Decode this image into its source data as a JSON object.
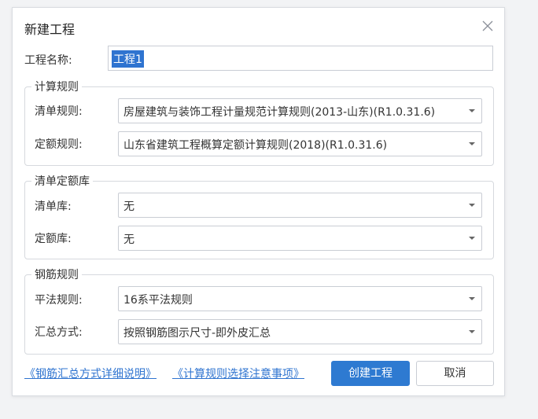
{
  "dialog": {
    "title": "新建工程",
    "close_icon": "close-icon"
  },
  "project_name": {
    "label": "工程名称:",
    "value": "工程1"
  },
  "calc_rules": {
    "group_title": "计算规则",
    "list_rule_label": "清单规则:",
    "list_rule_value": "房屋建筑与装饰工程计量规范计算规则(2013-山东)(R1.0.31.6)",
    "quota_rule_label": "定额规则:",
    "quota_rule_value": "山东省建筑工程概算定额计算规则(2018)(R1.0.31.6)"
  },
  "library": {
    "group_title": "清单定额库",
    "list_lib_label": "清单库:",
    "list_lib_value": "无",
    "quota_lib_label": "定额库:",
    "quota_lib_value": "无"
  },
  "rebar_rules": {
    "group_title": "钢筋规则",
    "flat_rule_label": "平法规则:",
    "flat_rule_value": "16系平法规则",
    "summary_label": "汇总方式:",
    "summary_value": "按照钢筋图示尺寸-即外皮汇总"
  },
  "footer": {
    "link_rebar": "《钢筋汇总方式详细说明》",
    "link_calc": "《计算规则选择注意事项》",
    "create_button": "创建工程",
    "cancel_button": "取消"
  },
  "colors": {
    "accent": "#2e7ad1",
    "link": "#2f74d0",
    "selection": "#2f74d0"
  }
}
